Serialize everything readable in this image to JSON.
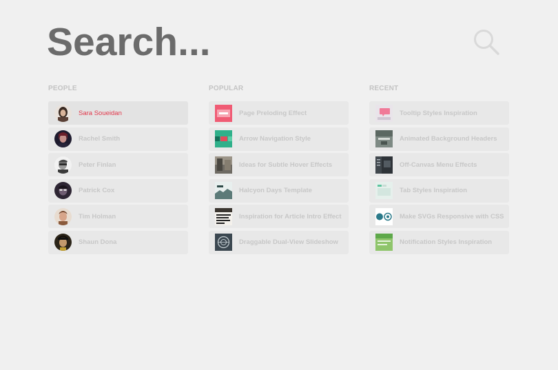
{
  "search": {
    "placeholder": "Search..."
  },
  "search_button": {
    "icon": "search-icon"
  },
  "columns": {
    "people": {
      "title": "PEOPLE",
      "items": [
        {
          "label": "Sara Soueidan",
          "active": true
        },
        {
          "label": "Rachel Smith"
        },
        {
          "label": "Peter Finlan"
        },
        {
          "label": "Patrick Cox"
        },
        {
          "label": "Tim Holman"
        },
        {
          "label": "Shaun Dona"
        }
      ]
    },
    "popular": {
      "title": "POPULAR",
      "items": [
        {
          "label": "Page Preloding Effect"
        },
        {
          "label": "Arrow Navigation Style"
        },
        {
          "label": "Ideas for Subtle Hover Effects"
        },
        {
          "label": "Halcyon Days Template"
        },
        {
          "label": "Inspiration for Article Intro Effect"
        },
        {
          "label": "Draggable Dual-View Slideshow"
        }
      ]
    },
    "recent": {
      "title": "RECENT",
      "items": [
        {
          "label": "Tooltip Styles Inspiration"
        },
        {
          "label": "Animated Background Headers"
        },
        {
          "label": "Off-Canvas Menu Effects"
        },
        {
          "label": "Tab Styles Inspiration"
        },
        {
          "label": "Make SVGs Responsive with CSS"
        },
        {
          "label": "Notification Styles Inspiration"
        }
      ]
    }
  },
  "colors": {
    "background": "#f0f0f0",
    "item_background": "#e8e8e8",
    "active_label": "#e2364a",
    "muted_label": "#c7c7c7",
    "search_text": "#6b6b6b"
  }
}
